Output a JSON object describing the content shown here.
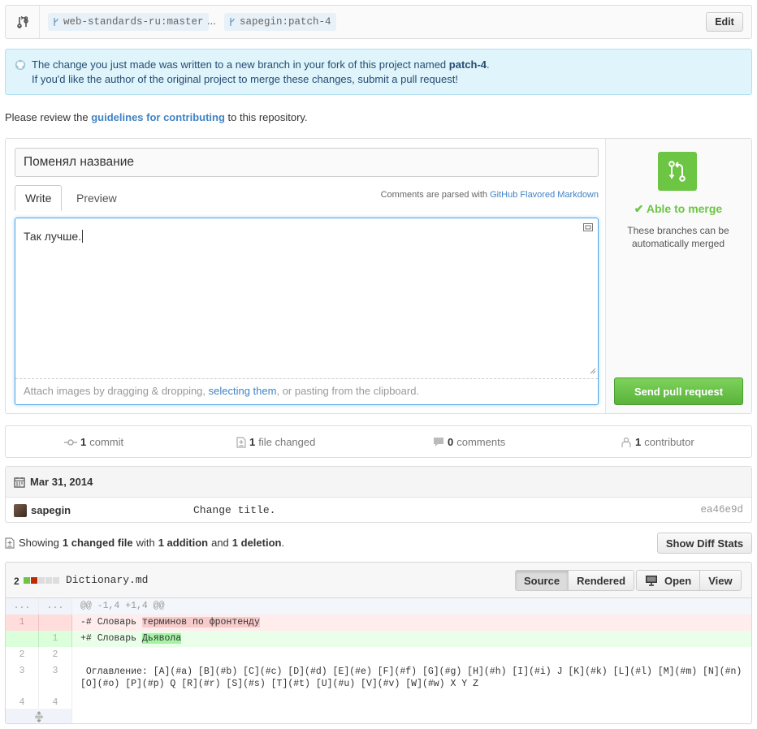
{
  "range": {
    "base_branch": "web-standards-ru:master",
    "dots": "...",
    "head_branch": "sapegin:patch-4",
    "edit_label": "Edit"
  },
  "flash": {
    "line1_prefix": "The change you just made was written to a new branch in your fork of this project named ",
    "branch_name": "patch-4",
    "line1_suffix": ".",
    "line2": "If you'd like the author of the original project to merge these changes, submit a pull request!"
  },
  "review": {
    "prefix": "Please review the ",
    "link": "guidelines for contributing",
    "suffix": " to this repository."
  },
  "compose": {
    "title_value": "Поменял название",
    "tab_write": "Write",
    "tab_preview": "Preview",
    "md_note_prefix": "Comments are parsed with ",
    "md_note_link": "GitHub Flavored Markdown",
    "body_value": "Так лучше.",
    "drop_prefix": "Attach images by dragging & dropping, ",
    "drop_link": "selecting them",
    "drop_suffix": ", or pasting from the clipboard."
  },
  "merge": {
    "status": "✔ Able to merge",
    "description": "These branches can be automatically merged",
    "send_label": "Send pull request",
    "accent": "#6cc644"
  },
  "stats": {
    "commits_count": "1",
    "commits_label": "commit",
    "files_count": "1",
    "files_label": "file changed",
    "comments_count": "0",
    "comments_label": "comments",
    "contributors_count": "1",
    "contributors_label": "contributor"
  },
  "commits": {
    "date": "Mar 31, 2014",
    "author": "sapegin",
    "message": "Change title.",
    "sha": "ea46e9d"
  },
  "toc": {
    "showing": "Showing",
    "changed": "1 changed file",
    "with": "with",
    "additions": "1 addition",
    "and": "and",
    "deletions": "1 deletion",
    "end": ".",
    "diffstat_label": "Show Diff Stats"
  },
  "file": {
    "change_count": "2",
    "name": "Dictionary.md",
    "source_label": "Source",
    "rendered_label": "Rendered",
    "open_label": "Open",
    "view_label": "View",
    "diff": {
      "hunk_old": "...",
      "hunk_new": "...",
      "hunk_header": "@@ -1,4 +1,4 @@",
      "del_ln": "1",
      "del_prefix": "-# Словарь ",
      "del_mark": "терминов по фронтенду",
      "add_ln": "1",
      "add_prefix": "+# Словарь ",
      "add_mark": "Дьявола",
      "ctx2_old": "2",
      "ctx2_new": "2",
      "ctx3_old": "3",
      "ctx3_new": "3",
      "ctx3_text": " Оглавление: [A](#a) [B](#b) [C](#c) [D](#d) [E](#e) [F](#f) [G](#g) [H](#h) [I](#i) J [K](#k) [L](#l) [M](#m) [N](#n) [O](#o) [P](#p) Q [R](#r) [S](#s) [T](#t) [U](#u) [V](#v) [W](#w) X Y Z",
      "ctx4_old": "4",
      "ctx4_new": "4"
    }
  }
}
